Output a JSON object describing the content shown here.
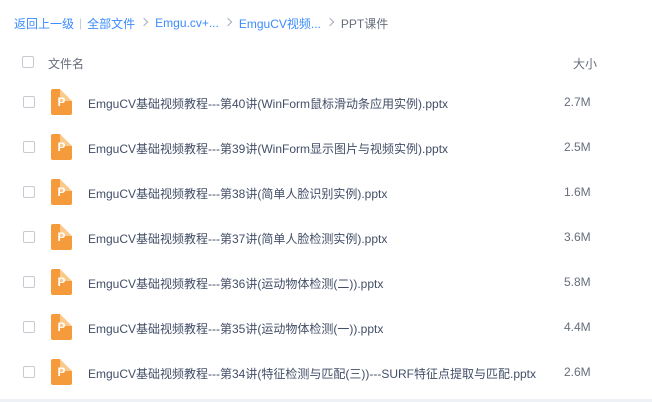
{
  "breadcrumb": {
    "back": "返回上一级",
    "all_files": "全部文件",
    "level1": "Emgu.cv+...",
    "level2": "EmguCV视频...",
    "current": "PPT课件"
  },
  "header": {
    "name_col": "文件名",
    "size_col": "大小"
  },
  "file_icon_letter": "P",
  "colors": {
    "link": "#3b8cff",
    "ppt_icon": "#f59b3c"
  },
  "files": [
    {
      "name": "EmguCV基础视频教程---第40讲(WinForm鼠标滑动条应用实例).pptx",
      "size": "2.7M",
      "icon": "ppt-file-icon"
    },
    {
      "name": "EmguCV基础视频教程---第39讲(WinForm显示图片与视频实例).pptx",
      "size": "2.5M",
      "icon": "ppt-file-icon"
    },
    {
      "name": "EmguCV基础视频教程---第38讲(简单人脸识别实例).pptx",
      "size": "1.6M",
      "icon": "ppt-file-icon"
    },
    {
      "name": "EmguCV基础视频教程---第37讲(简单人脸检测实例).pptx",
      "size": "3.6M",
      "icon": "ppt-file-icon"
    },
    {
      "name": "EmguCV基础视频教程---第36讲(运动物体检测(二)).pptx",
      "size": "5.8M",
      "icon": "ppt-file-icon"
    },
    {
      "name": "EmguCV基础视频教程---第35讲(运动物体检测(一)).pptx",
      "size": "4.4M",
      "icon": "ppt-file-icon"
    },
    {
      "name": "EmguCV基础视频教程---第34讲(特征检测与匹配(三))---SURF特征点提取与匹配.pptx",
      "size": "2.6M",
      "icon": "ppt-file-icon"
    }
  ]
}
